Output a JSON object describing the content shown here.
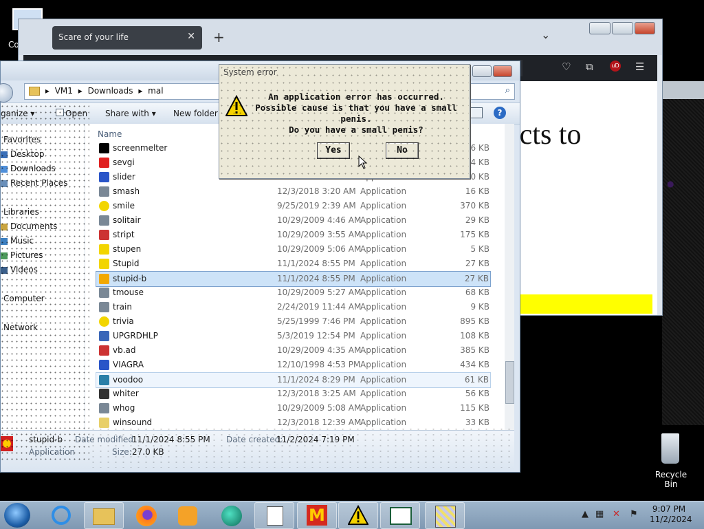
{
  "desktop": {
    "computer_icon_label": "Co",
    "recycle_bin_label": "Recycle Bin"
  },
  "browser": {
    "tab_title": "Scare of your life",
    "tab_close": "✕",
    "new_tab": "+",
    "tab_list": "⌄",
    "content_text": "ects to",
    "accent_yellow": "#ffff00",
    "addon_badge": "uD"
  },
  "explorer": {
    "breadcrumb": [
      "VM1",
      "Downloads",
      "mal"
    ],
    "toolbar": {
      "organize": "ganize ▾",
      "open": "Open",
      "share_with": "Share with ▾",
      "new_folder": "New folder",
      "help": "?"
    },
    "nav": {
      "favorites": "Favorites",
      "desktop": "Desktop",
      "downloads": "Downloads",
      "recent": "Recent Places",
      "libraries": "Libraries",
      "documents": "Documents",
      "music": "Music",
      "pictures": "Pictures",
      "videos": "Videos",
      "computer": "Computer",
      "network": "Network"
    },
    "column_name": "Name",
    "rows": [
      {
        "name": "screenmelter",
        "date": "",
        "type": "",
        "size": "6 KB"
      },
      {
        "name": "sevgi",
        "date": "",
        "type": "",
        "size": "4 KB"
      },
      {
        "name": "slider",
        "date": "",
        "type": "Application",
        "size": "40 KB"
      },
      {
        "name": "smash",
        "date": "12/3/2018 3:20 AM",
        "type": "Application",
        "size": "16 KB"
      },
      {
        "name": "smile",
        "date": "9/25/2019 2:39 AM",
        "type": "Application",
        "size": "370 KB"
      },
      {
        "name": "solitair",
        "date": "10/29/2009 4:46 AM",
        "type": "Application",
        "size": "29 KB"
      },
      {
        "name": "stript",
        "date": "10/29/2009 3:55 AM",
        "type": "Application",
        "size": "175 KB"
      },
      {
        "name": "stupen",
        "date": "10/29/2009 5:06 AM",
        "type": "Application",
        "size": "5 KB"
      },
      {
        "name": "Stupid",
        "date": "11/1/2024 8:55 PM",
        "type": "Application",
        "size": "27 KB"
      },
      {
        "name": "stupid-b",
        "date": "11/1/2024 8:55 PM",
        "type": "Application",
        "size": "27 KB"
      },
      {
        "name": "tmouse",
        "date": "10/29/2009 5:27 AM",
        "type": "Application",
        "size": "68 KB"
      },
      {
        "name": "train",
        "date": "2/24/2019 11:44 AM",
        "type": "Application",
        "size": "9 KB"
      },
      {
        "name": "trivia",
        "date": "5/25/1999 7:46 PM",
        "type": "Application",
        "size": "895 KB"
      },
      {
        "name": "UPGRDHLP",
        "date": "5/3/2019 12:54 PM",
        "type": "Application",
        "size": "108 KB"
      },
      {
        "name": "vb.ad",
        "date": "10/29/2009 4:35 AM",
        "type": "Application",
        "size": "385 KB"
      },
      {
        "name": "VIAGRA",
        "date": "12/10/1998 4:53 PM",
        "type": "Application",
        "size": "434 KB"
      },
      {
        "name": "voodoo",
        "date": "11/1/2024 8:29 PM",
        "type": "Application",
        "size": "61 KB"
      },
      {
        "name": "whiter",
        "date": "12/3/2018 3:25 AM",
        "type": "Application",
        "size": "56 KB"
      },
      {
        "name": "whog",
        "date": "10/29/2009 5:08 AM",
        "type": "Application",
        "size": "115 KB"
      },
      {
        "name": "winsound",
        "date": "12/3/2018 12:39 AM",
        "type": "Application",
        "size": "33 KB"
      }
    ],
    "details": {
      "name": "stupid-b",
      "kind": "Application",
      "modified_label": "Date modified:",
      "modified_value": "11/1/2024 8:55 PM",
      "created_label": "Date created:",
      "created_value": "11/2/2024 7:19 PM",
      "size_label": "Size:",
      "size_value": "27.0 KB"
    }
  },
  "dialog": {
    "title": "System error",
    "line1": "An application error has occurred.",
    "line2": "Possible cause is that you have a small penis.",
    "line3": "Do you have a small penis?",
    "yes": "Yes",
    "no": "No"
  },
  "taskbar": {
    "time": "9:07 PM",
    "date": "11/2/2024"
  }
}
